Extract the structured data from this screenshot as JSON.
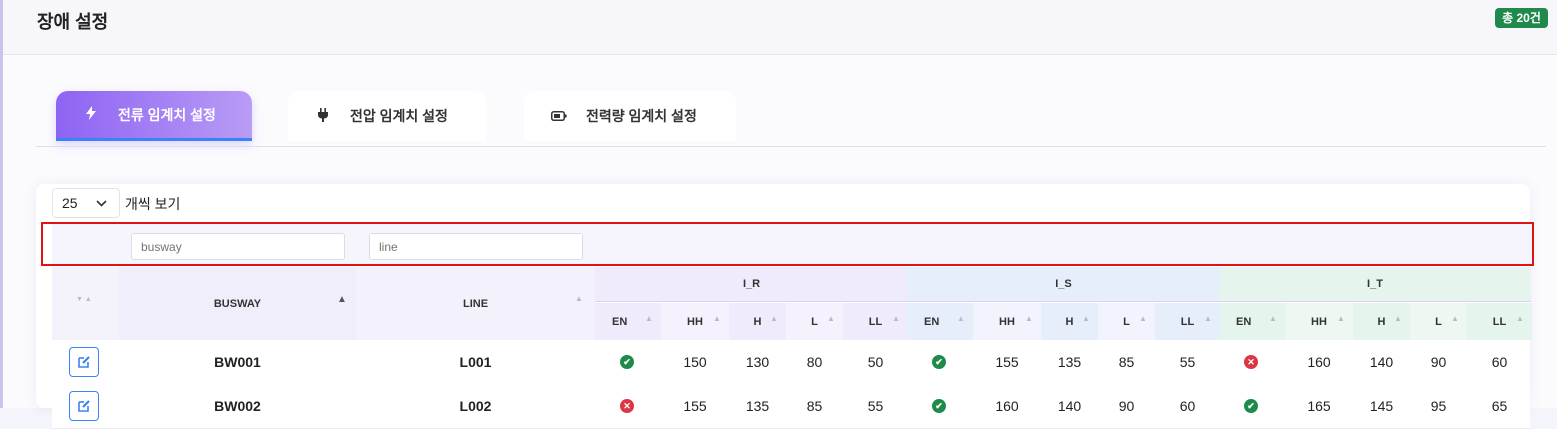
{
  "header": {
    "title": "장애 설정",
    "total_badge": "총 20건"
  },
  "tabs": [
    {
      "label": "전류 임계치 설정",
      "icon": "lightning-icon",
      "active": true
    },
    {
      "label": "전압 임계치 설정",
      "icon": "plug-icon",
      "active": false
    },
    {
      "label": "전력량 임계치 설정",
      "icon": "battery-icon",
      "active": false
    }
  ],
  "table_controls": {
    "page_size": "25",
    "page_size_label": "개씩 보기"
  },
  "filters": {
    "busway_placeholder": "busway",
    "line_placeholder": "line"
  },
  "columns": {
    "busway": "BUSWAY",
    "line": "LINE",
    "groups": [
      "I_R",
      "I_S",
      "I_T"
    ],
    "sub": [
      "EN",
      "HH",
      "H",
      "L",
      "LL"
    ]
  },
  "colors": {
    "accent": "#8e63f3",
    "enabled": "#1f8a4c",
    "disabled": "#dc3545",
    "badge": "#1f8a4c",
    "highlight": "#e11212"
  },
  "rows": [
    {
      "busway": "BW001",
      "line": "L001",
      "I_R": {
        "en": true,
        "hh": "150",
        "h": "130",
        "l": "80",
        "ll": "50"
      },
      "I_S": {
        "en": true,
        "hh": "155",
        "h": "135",
        "l": "85",
        "ll": "55"
      },
      "I_T": {
        "en": false,
        "hh": "160",
        "h": "140",
        "l": "90",
        "ll": "60"
      }
    },
    {
      "busway": "BW002",
      "line": "L002",
      "I_R": {
        "en": false,
        "hh": "155",
        "h": "135",
        "l": "85",
        "ll": "55"
      },
      "I_S": {
        "en": true,
        "hh": "160",
        "h": "140",
        "l": "90",
        "ll": "60"
      },
      "I_T": {
        "en": true,
        "hh": "165",
        "h": "145",
        "l": "95",
        "ll": "65"
      }
    }
  ]
}
